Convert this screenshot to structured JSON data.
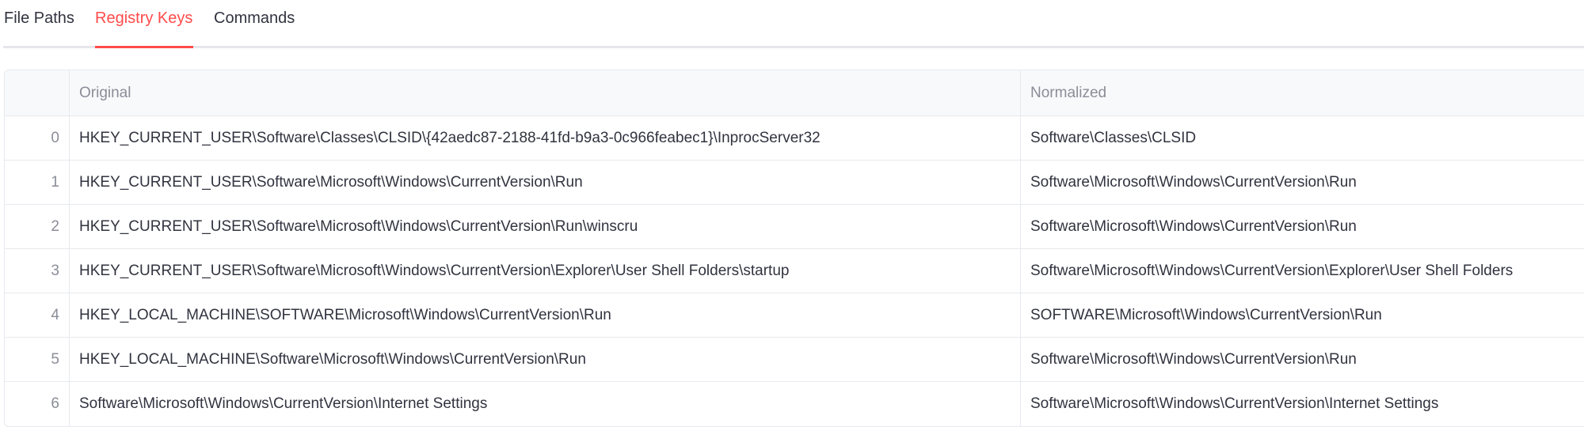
{
  "tabs": [
    {
      "label": "File Paths",
      "active": false
    },
    {
      "label": "Registry Keys",
      "active": true
    },
    {
      "label": "Commands",
      "active": false
    }
  ],
  "colors": {
    "accent": "#ff4b4b",
    "text": "#31333f",
    "muted": "#8b8d97",
    "border": "#e6e9ef",
    "header_bg": "#f8f9fb"
  },
  "table": {
    "columns": [
      "Original",
      "Normalized"
    ],
    "rows": [
      {
        "index": "0",
        "original": "HKEY_CURRENT_USER\\Software\\Classes\\CLSID\\{42aedc87-2188-41fd-b9a3-0c966feabec1}\\InprocServer32",
        "normalized": "Software\\Classes\\CLSID"
      },
      {
        "index": "1",
        "original": "HKEY_CURRENT_USER\\Software\\Microsoft\\Windows\\CurrentVersion\\Run",
        "normalized": "Software\\Microsoft\\Windows\\CurrentVersion\\Run"
      },
      {
        "index": "2",
        "original": "HKEY_CURRENT_USER\\Software\\Microsoft\\Windows\\CurrentVersion\\Run\\winscru",
        "normalized": "Software\\Microsoft\\Windows\\CurrentVersion\\Run"
      },
      {
        "index": "3",
        "original": "HKEY_CURRENT_USER\\Software\\Microsoft\\Windows\\CurrentVersion\\Explorer\\User Shell Folders\\startup",
        "normalized": "Software\\Microsoft\\Windows\\CurrentVersion\\Explorer\\User Shell Folders"
      },
      {
        "index": "4",
        "original": "HKEY_LOCAL_MACHINE\\SOFTWARE\\Microsoft\\Windows\\CurrentVersion\\Run",
        "normalized": "SOFTWARE\\Microsoft\\Windows\\CurrentVersion\\Run"
      },
      {
        "index": "5",
        "original": "HKEY_LOCAL_MACHINE\\Software\\Microsoft\\Windows\\CurrentVersion\\Run",
        "normalized": "Software\\Microsoft\\Windows\\CurrentVersion\\Run"
      },
      {
        "index": "6",
        "original": "Software\\Microsoft\\Windows\\CurrentVersion\\Internet Settings",
        "normalized": "Software\\Microsoft\\Windows\\CurrentVersion\\Internet Settings"
      }
    ]
  }
}
